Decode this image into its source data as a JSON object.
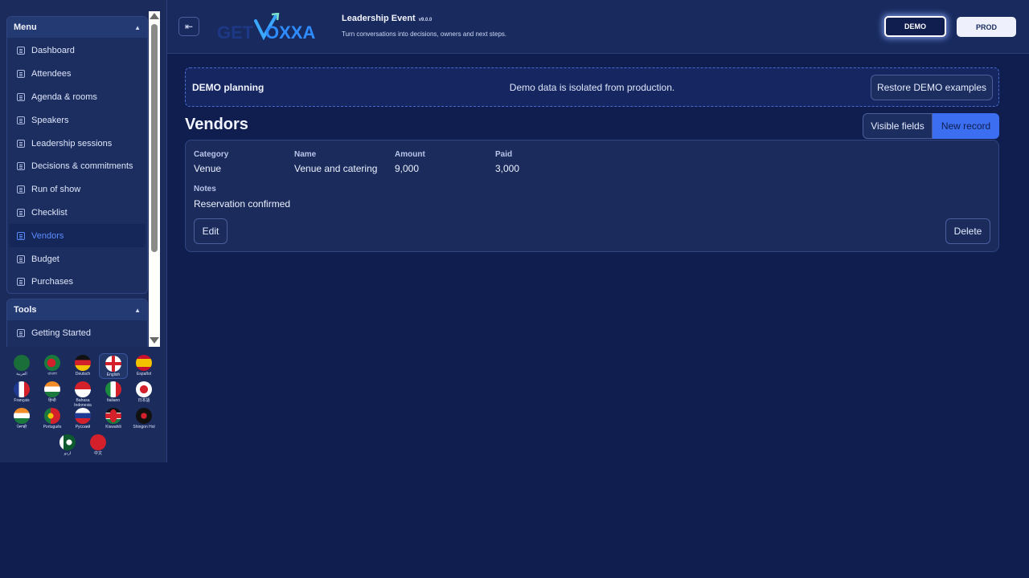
{
  "sidebar": {
    "menu_title": "Menu",
    "items": [
      {
        "label": "Dashboard"
      },
      {
        "label": "Attendees"
      },
      {
        "label": "Agenda & rooms"
      },
      {
        "label": "Speakers"
      },
      {
        "label": "Leadership sessions"
      },
      {
        "label": "Decisions & commitments"
      },
      {
        "label": "Run of show"
      },
      {
        "label": "Checklist"
      },
      {
        "label": "Vendors"
      },
      {
        "label": "Budget"
      },
      {
        "label": "Purchases"
      }
    ],
    "active_item": "Vendors",
    "tools_title": "Tools",
    "tools_items": [
      {
        "label": "Getting Started"
      }
    ]
  },
  "languages": [
    {
      "label": "العربية"
    },
    {
      "label": "বাংলা"
    },
    {
      "label": "Deutsch"
    },
    {
      "label": "English"
    },
    {
      "label": "Español"
    },
    {
      "label": "Français"
    },
    {
      "label": "हिन्दी"
    },
    {
      "label": "Bahasa Indonesia"
    },
    {
      "label": "Italiano"
    },
    {
      "label": "日本語"
    },
    {
      "label": "ਪੰਜਾਬੀ"
    },
    {
      "label": "Português"
    },
    {
      "label": "Русский"
    },
    {
      "label": "Kiswahili"
    },
    {
      "label": "Shingon Hol"
    },
    {
      "label": "اردو"
    },
    {
      "label": "中文"
    }
  ],
  "active_language": "English",
  "header": {
    "logo_text_left": "GET",
    "logo_text_right": "OXXA",
    "event_title": "Leadership Event",
    "version": "v9.0.0",
    "subtitle": "Turn conversations into decisions, owners and next steps.",
    "demo_label": "DEMO",
    "prod_label": "PROD"
  },
  "banner": {
    "title": "DEMO planning",
    "message": "Demo data is isolated from production.",
    "restore_label": "Restore DEMO examples"
  },
  "page": {
    "title": "Vendors",
    "visible_fields_label": "Visible fields",
    "new_record_label": "New record"
  },
  "record": {
    "labels": {
      "category": "Category",
      "name": "Name",
      "amount": "Amount",
      "paid": "Paid",
      "notes": "Notes"
    },
    "category": "Venue",
    "name": "Venue and catering",
    "amount": "9,000",
    "paid": "3,000",
    "notes": "Reservation confirmed",
    "edit_label": "Edit",
    "delete_label": "Delete"
  },
  "colors": {
    "accent": "#3b6ef0",
    "background": "#0f1d4f",
    "panel": "#1a2b5c"
  }
}
